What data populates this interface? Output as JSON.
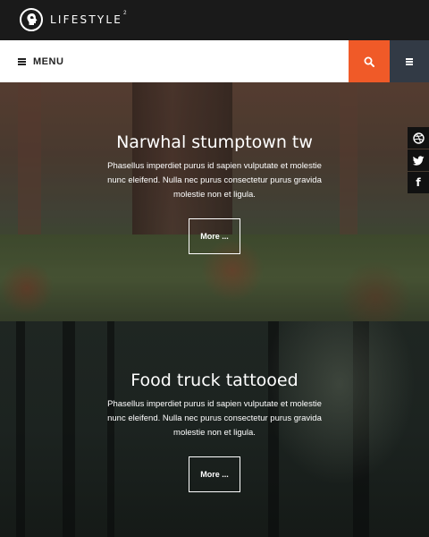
{
  "brand": {
    "name": "LIFESTYLE",
    "superscript": "2"
  },
  "menubar": {
    "menu_label": "MENU"
  },
  "social": [
    {
      "name": "dribbble",
      "glyph": "◎"
    },
    {
      "name": "twitter",
      "glyph": "🐦"
    },
    {
      "name": "facebook",
      "glyph": "f"
    }
  ],
  "posts": [
    {
      "title": "Narwhal stumptown tw",
      "body": "Phasellus imperdiet purus id sapien vulputate et molestie nunc eleifend. Nulla nec purus consectetur purus gravida molestie non et ligula.",
      "button": "More ..."
    },
    {
      "title": "Food truck tattooed",
      "body": "Phasellus imperdiet purus id sapien vulputate et molestie nunc eleifend. Nulla nec purus consectetur purus gravida molestie non et ligula.",
      "button": "More ..."
    }
  ],
  "colors": {
    "accent": "#f05a28",
    "side": "#323a45",
    "topbar": "#1a1a1a"
  }
}
